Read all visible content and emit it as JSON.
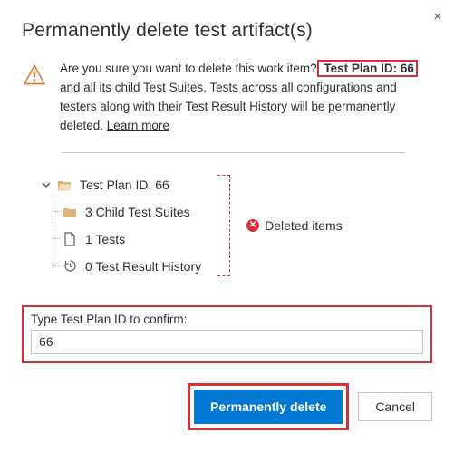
{
  "dialog": {
    "title": "Permanently delete test artifact(s)",
    "close_label": "×"
  },
  "warning": {
    "text_before": "Are you sure you want to delete this work item?",
    "highlight": " Test Plan ID: 66 ",
    "text_after": "and all its child Test Suites, Tests across all configurations and testers along with their Test Result History will be permanently deleted. ",
    "learn_more": "Learn more"
  },
  "tree": {
    "root": "Test Plan ID: 66",
    "children": [
      "3 Child Test Suites",
      "1 Tests",
      "0 Test Result History"
    ]
  },
  "deleted_label": "Deleted items",
  "confirm": {
    "label": "Type Test Plan ID to confirm:",
    "value": "66"
  },
  "buttons": {
    "primary": "Permanently delete",
    "cancel": "Cancel"
  }
}
